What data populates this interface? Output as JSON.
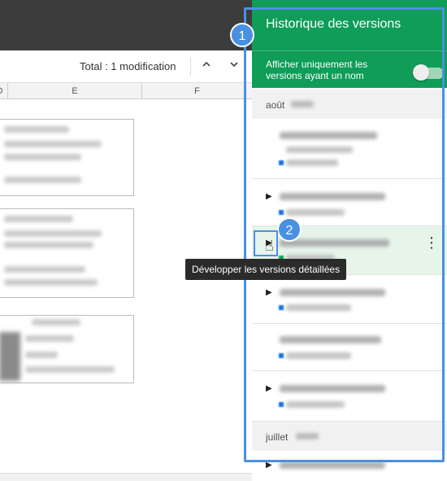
{
  "toolbar": {
    "total_label": "Total : 1 modification",
    "prev_icon": "chevron-up-icon",
    "next_icon": "chevron-down-icon"
  },
  "sheet": {
    "columns": [
      "D",
      "E",
      "F"
    ]
  },
  "panel": {
    "title": "Historique des versions",
    "filter_label": "Afficher uniquement les versions ayant un nom",
    "filter_on": false,
    "months": [
      "août",
      "juillet"
    ]
  },
  "tooltip": "Développer les versions détaillées",
  "annotations": {
    "badge1": "1",
    "badge2": "2"
  },
  "colors": {
    "accent": "#0f9d58",
    "highlight": "#4a90e2"
  }
}
